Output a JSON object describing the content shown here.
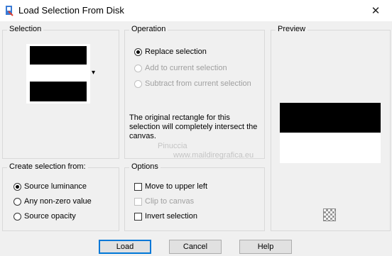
{
  "window": {
    "title": "Load Selection From Disk",
    "close_glyph": "✕"
  },
  "selection_group": {
    "title": "Selection",
    "thumbnail": "black-white-black-bars",
    "dropdown_glyph": "▾"
  },
  "operation_group": {
    "title": "Operation",
    "options": [
      {
        "label": "Replace selection",
        "selected": true,
        "enabled": true
      },
      {
        "label": "Add to current selection",
        "selected": false,
        "enabled": false
      },
      {
        "label": "Subtract from current selection",
        "selected": false,
        "enabled": false
      }
    ],
    "message": "The original rectangle for this selection will completely intersect the canvas."
  },
  "preview_group": {
    "title": "Preview",
    "zoom_icon": "checkered-zoom-icon"
  },
  "create_group": {
    "title": "Create selection from:",
    "options": [
      {
        "label": "Source luminance",
        "selected": true
      },
      {
        "label": "Any non-zero value",
        "selected": false
      },
      {
        "label": "Source opacity",
        "selected": false
      }
    ]
  },
  "options_group": {
    "title": "Options",
    "items": [
      {
        "label": "Move to upper left",
        "checked": false,
        "enabled": true
      },
      {
        "label": "Clip to canvas",
        "checked": false,
        "enabled": false
      },
      {
        "label": "Invert selection",
        "checked": false,
        "enabled": true
      }
    ]
  },
  "buttons": {
    "load": "Load",
    "cancel": "Cancel",
    "help": "Help"
  },
  "watermark": {
    "line1": "Pinuccia",
    "line2": "www.maildiregrafica.eu"
  }
}
